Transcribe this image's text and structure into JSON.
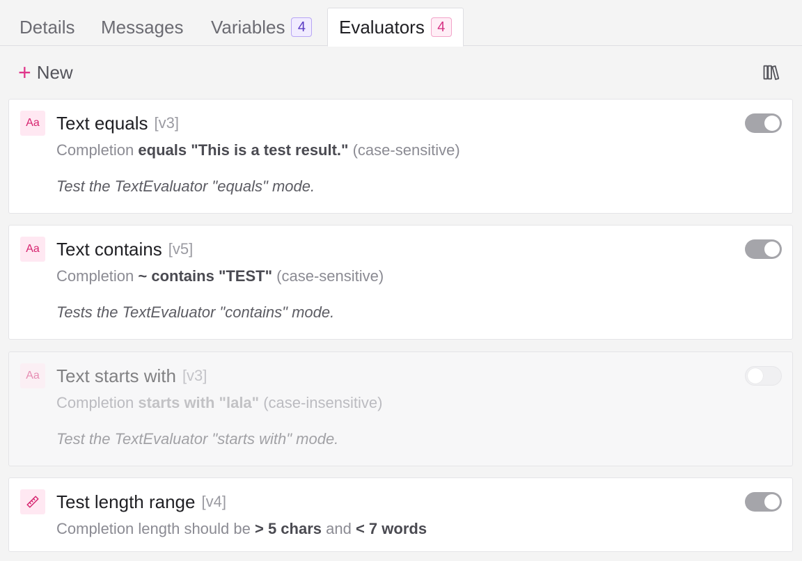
{
  "tabs": {
    "details": "Details",
    "messages": "Messages",
    "variables": "Variables",
    "variables_count": "4",
    "evaluators": "Evaluators",
    "evaluators_count": "4"
  },
  "toolbar": {
    "new_plus": "+",
    "new_label": "New"
  },
  "evaluators": [
    {
      "icon_text": "Aa",
      "title": "Text equals",
      "version": "[v3]",
      "summary_prefix": "Completion",
      "summary_strong": "equals \"This is a test result.\"",
      "summary_suffix": "(case-sensitive)",
      "description": "Test the TextEvaluator \"equals\" mode.",
      "enabled": true
    },
    {
      "icon_text": "Aa",
      "title": "Text contains",
      "version": "[v5]",
      "summary_prefix": "Completion",
      "summary_strong": "~ contains \"TEST\"",
      "summary_suffix": "(case-sensitive)",
      "description": "Tests the TextEvaluator \"contains\" mode.",
      "enabled": true
    },
    {
      "icon_text": "Aa",
      "title": "Text starts with",
      "version": "[v3]",
      "summary_prefix": "Completion",
      "summary_strong": "starts with \"lala\"",
      "summary_suffix": "(case-insensitive)",
      "description": "Test the TextEvaluator \"starts with\" mode.",
      "enabled": false
    },
    {
      "icon": "ruler-icon",
      "title": "Test length range",
      "version": "[v4]",
      "summary_prefix": "Completion length should be",
      "summary_strong_1": "> 5 chars",
      "summary_mid": "and",
      "summary_strong_2": "< 7 words",
      "enabled": true
    }
  ],
  "colors": {
    "accent": "#e0368a",
    "icon_bg": "#ffe8f2",
    "toggle_on": "#a5a5aa"
  }
}
